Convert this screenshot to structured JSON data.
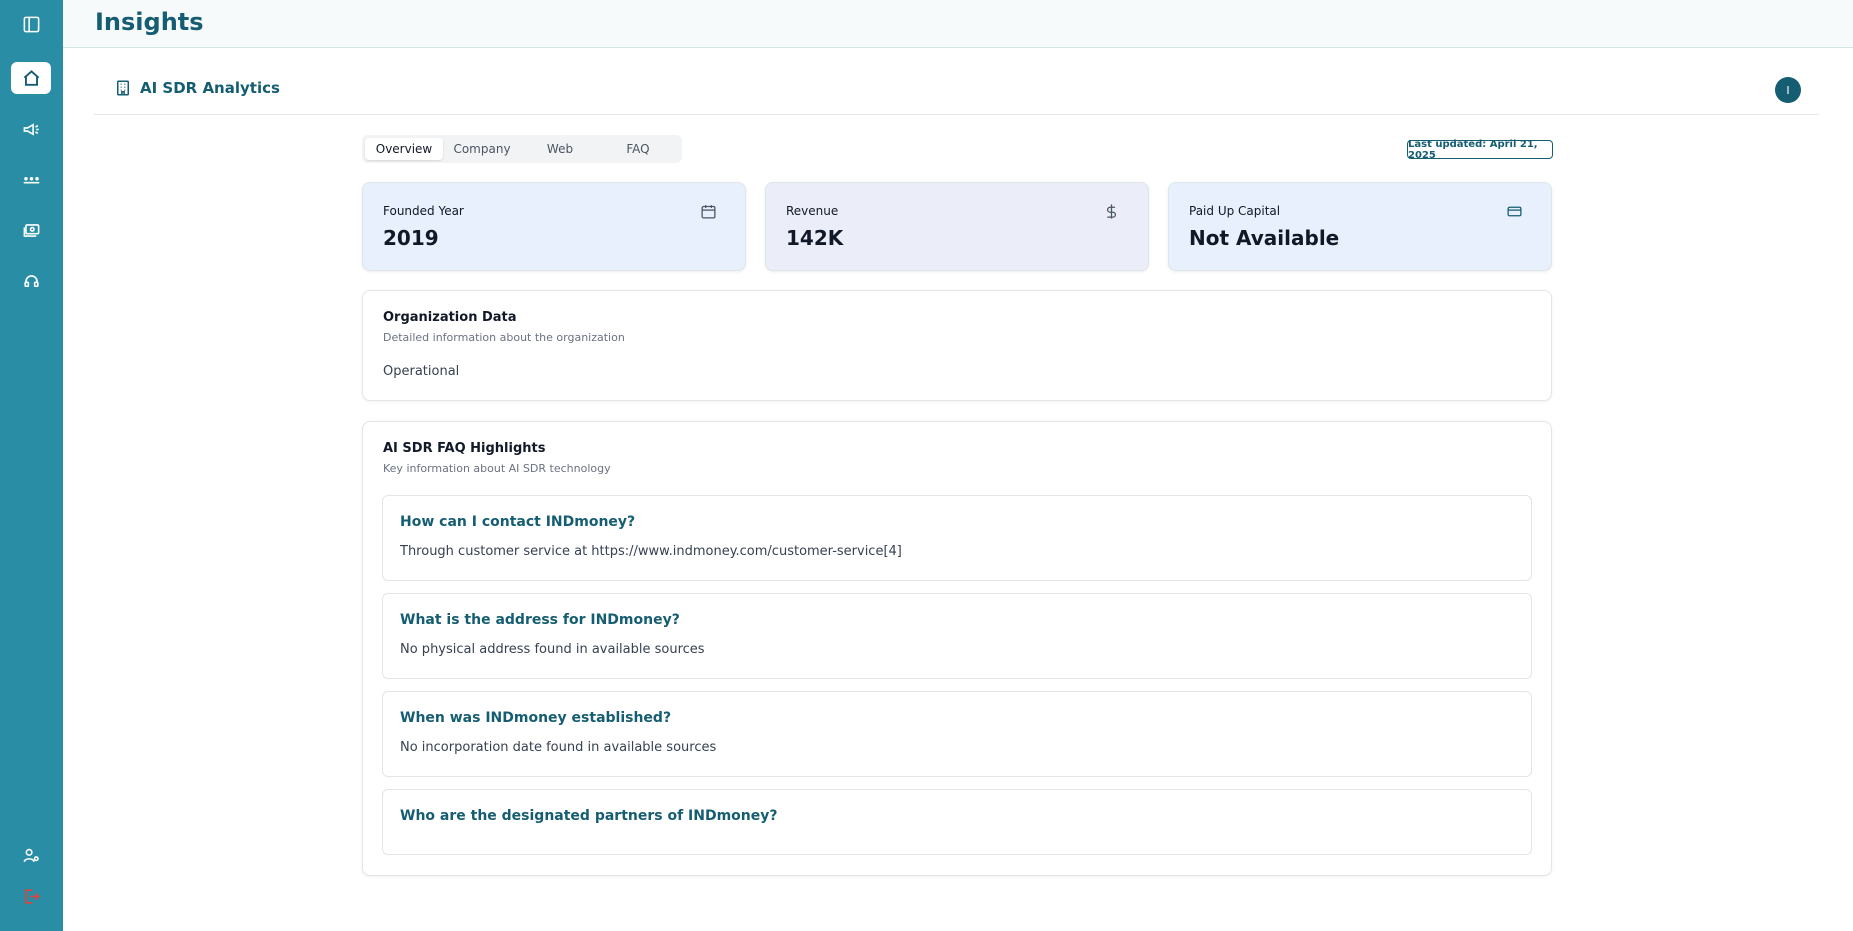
{
  "header": {
    "title": "Insights"
  },
  "subheader": {
    "title": "AI SDR Analytics",
    "avatar_initial": "I"
  },
  "sidebar": {
    "icons": [
      "panel-toggle-icon",
      "home-icon",
      "megaphone-icon",
      "dots-icon",
      "cash-icon",
      "support-icon",
      "user-settings-icon",
      "logout-icon"
    ],
    "active": "home-icon",
    "accent": "#2a8da6",
    "logout_color": "#e0413a"
  },
  "tabs": [
    {
      "label": "Overview",
      "active": true
    },
    {
      "label": "Company",
      "active": false
    },
    {
      "label": "Web",
      "active": false
    },
    {
      "label": "FAQ",
      "active": false
    }
  ],
  "last_updated": "Last updated: April 21, 2025",
  "stats": [
    {
      "label": "Founded Year",
      "value": "2019",
      "icon": "calendar-icon",
      "bg": "#e7f0fc"
    },
    {
      "label": "Revenue",
      "value": "142K",
      "icon": "dollar-icon",
      "bg": "#ebedf9"
    },
    {
      "label": "Paid Up Capital",
      "value": "Not Available",
      "icon": "credit-card-icon",
      "bg": "#e7f0fc"
    }
  ],
  "organization": {
    "title": "Organization Data",
    "subtitle": "Detailed information about the organization",
    "status": "Operational"
  },
  "faq_section": {
    "title": "AI SDR FAQ Highlights",
    "subtitle": "Key information about AI SDR technology",
    "items": [
      {
        "q": "How can I contact INDmoney?",
        "a": "Through customer service at https://www.indmoney.com/customer-service[4]"
      },
      {
        "q": "What is the address for INDmoney?",
        "a": "No physical address found in available sources"
      },
      {
        "q": "When was INDmoney established?",
        "a": "No incorporation date found in available sources"
      },
      {
        "q": "Who are the designated partners of INDmoney?",
        "a": ""
      }
    ]
  }
}
